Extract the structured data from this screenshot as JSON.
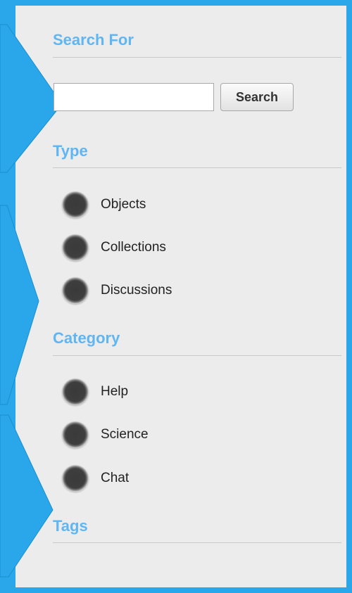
{
  "search_for": {
    "title": "Search For",
    "input_value": "",
    "input_placeholder": "",
    "button_label": "Search"
  },
  "type": {
    "title": "Type",
    "options": [
      {
        "label": "Objects"
      },
      {
        "label": "Collections"
      },
      {
        "label": "Discussions"
      }
    ]
  },
  "category": {
    "title": "Category",
    "options": [
      {
        "label": "Help"
      },
      {
        "label": "Science"
      },
      {
        "label": "Chat"
      }
    ]
  },
  "tags": {
    "title": "Tags"
  },
  "colors": {
    "accent_blue": "#2aa7ea",
    "section_title": "#5fb6f2",
    "panel_bg": "#ececec"
  }
}
